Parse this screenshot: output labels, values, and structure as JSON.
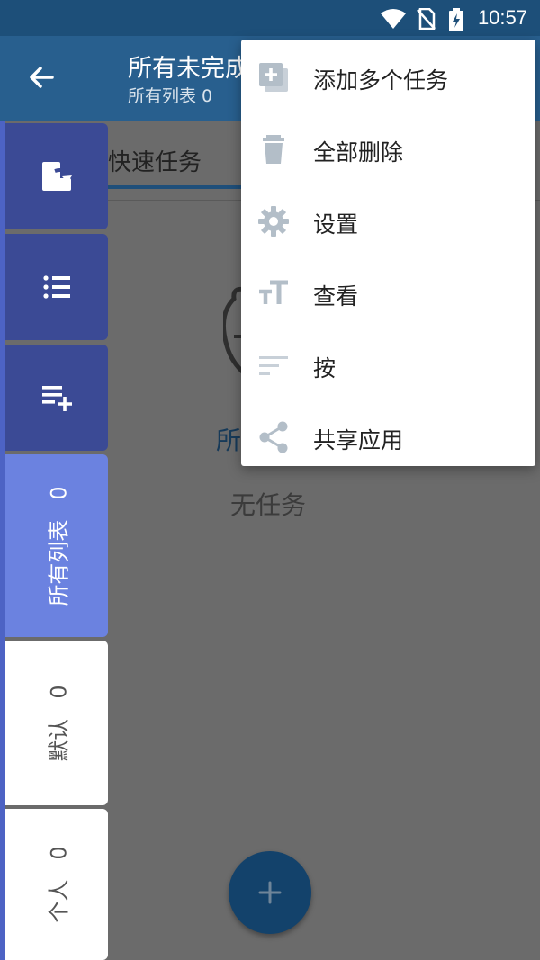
{
  "status_bar": {
    "time": "10:57"
  },
  "app_bar": {
    "title": "所有未完成",
    "subtitle": "所有列表 0"
  },
  "main": {
    "tab_label": "快速任务",
    "empty_list_name": "所有列表",
    "empty_text": "无任务",
    "fab_label": "+"
  },
  "sidebar": {
    "lists": [
      {
        "name": "所有列表",
        "count": "0"
      },
      {
        "name": "默认",
        "count": "0"
      },
      {
        "name": "个人",
        "count": "0"
      }
    ]
  },
  "menu": {
    "items": [
      {
        "label": "添加多个任务",
        "icon": "add-multiple-icon"
      },
      {
        "label": "全部删除",
        "icon": "trash-icon"
      },
      {
        "label": "设置",
        "icon": "gear-icon"
      },
      {
        "label": "查看",
        "icon": "text-size-icon"
      },
      {
        "label": "按",
        "icon": "sort-icon"
      },
      {
        "label": "共享应用",
        "icon": "share-icon"
      }
    ]
  },
  "colors": {
    "primary_dark": "#1d4f79",
    "primary": "#285f8e",
    "accent": "#4d63c4",
    "sidebar_button": "#3b4a95",
    "icon_gray": "#b9c3cc"
  }
}
